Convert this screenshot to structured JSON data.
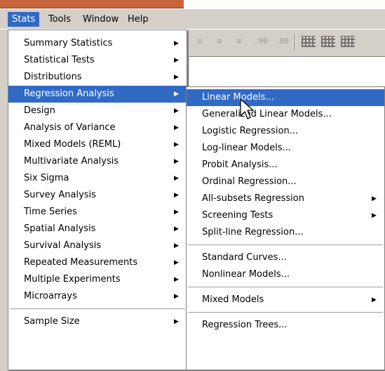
{
  "menubar": {
    "items": [
      {
        "label": "Stats",
        "active": true
      },
      {
        "label": "Tools",
        "active": false
      },
      {
        "label": "Window",
        "active": false
      },
      {
        "label": "Help",
        "active": false
      }
    ]
  },
  "toolbar": {
    "icons": [
      "align-center-icon",
      "align-right-icon",
      "increase-decimal-icon",
      "decrease-decimal-icon",
      "table-grid-icon",
      "table-grid-icon"
    ],
    "decimal_up": ".00",
    "decimal_down": ".00"
  },
  "stats_menu": {
    "items": [
      {
        "label": "Summary Statistics",
        "submenu": true
      },
      {
        "label": "Statistical Tests",
        "submenu": true
      },
      {
        "label": "Distributions",
        "submenu": true
      },
      {
        "label": "Regression Analysis",
        "submenu": true,
        "highlight": true
      },
      {
        "label": "Design",
        "submenu": true
      },
      {
        "label": "Analysis of Variance",
        "submenu": true
      },
      {
        "label": "Mixed Models (REML)",
        "submenu": true
      },
      {
        "label": "Multivariate Analysis",
        "submenu": true
      },
      {
        "label": "Six Sigma",
        "submenu": true
      },
      {
        "label": "Survey Analysis",
        "submenu": true
      },
      {
        "label": "Time Series",
        "submenu": true
      },
      {
        "label": "Spatial Analysis",
        "submenu": true
      },
      {
        "label": "Survival Analysis",
        "submenu": true
      },
      {
        "label": "Repeated Measurements",
        "submenu": true
      },
      {
        "label": "Multiple Experiments",
        "submenu": true
      },
      {
        "label": "Microarrays",
        "submenu": true
      },
      {
        "separator": true
      },
      {
        "label": "Sample Size",
        "submenu": true
      }
    ]
  },
  "regression_menu": {
    "items": [
      {
        "label": "Linear Models...",
        "submenu": false,
        "highlight": true
      },
      {
        "label": "Generalized Linear Models...",
        "submenu": false
      },
      {
        "label": "Logistic Regression...",
        "submenu": false
      },
      {
        "label": "Log-linear Models...",
        "submenu": false
      },
      {
        "label": "Probit Analysis...",
        "submenu": false
      },
      {
        "label": "Ordinal Regression...",
        "submenu": false
      },
      {
        "label": "All-subsets Regression",
        "submenu": true
      },
      {
        "label": "Screening Tests",
        "submenu": true
      },
      {
        "label": "Split-line Regression...",
        "submenu": false
      },
      {
        "separator": true
      },
      {
        "label": "Standard Curves...",
        "submenu": false
      },
      {
        "label": "Nonlinear Models...",
        "submenu": false
      },
      {
        "separator": true
      },
      {
        "label": "Mixed Models",
        "submenu": true
      },
      {
        "separator": true
      },
      {
        "label": "Regression Trees...",
        "submenu": false
      }
    ]
  },
  "colors": {
    "highlight": "#316ac5",
    "menu_bg": "#ffffff",
    "chrome": "#d4d0c8"
  }
}
